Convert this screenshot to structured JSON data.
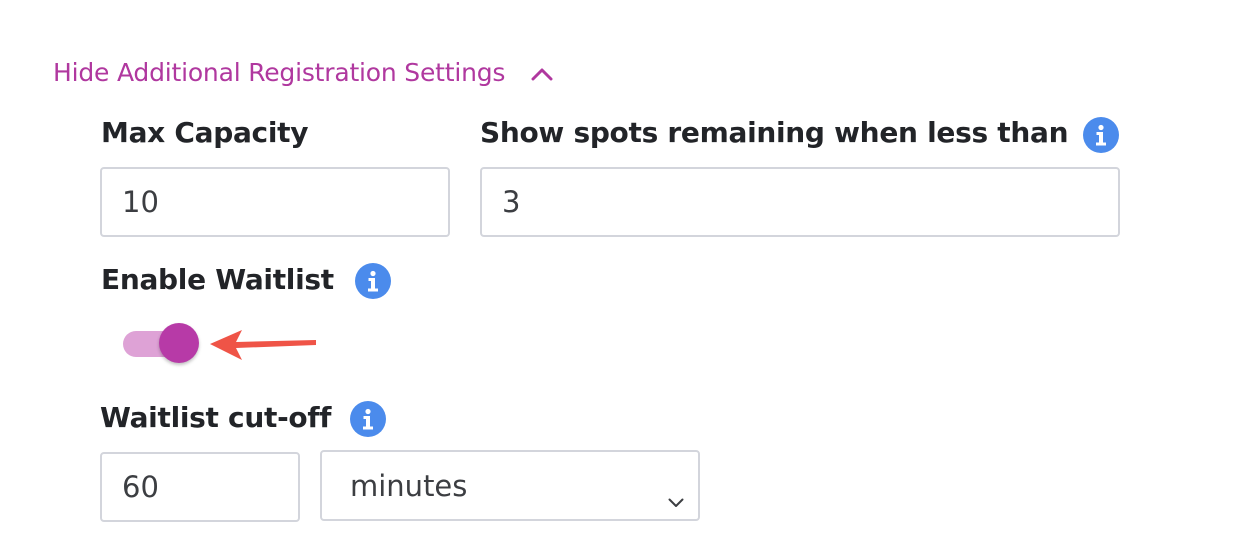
{
  "section_toggle": {
    "label": "Hide Additional Registration Settings",
    "icon": "chevron-up-icon",
    "color": "#b0389f"
  },
  "max_capacity": {
    "label": "Max Capacity",
    "value": "10"
  },
  "spots_remaining": {
    "label": "Show spots remaining when less than",
    "value": "3",
    "info_icon": "info-icon"
  },
  "waitlist": {
    "label": "Enable Waitlist",
    "info_icon": "info-icon",
    "enabled": true,
    "accent": "#b73aa7"
  },
  "waitlist_cutoff": {
    "label": "Waitlist cut-off",
    "value": "60",
    "unit_selected": "minutes",
    "info_icon": "info-icon"
  },
  "annotation": {
    "arrow_color": "#ef5447"
  }
}
